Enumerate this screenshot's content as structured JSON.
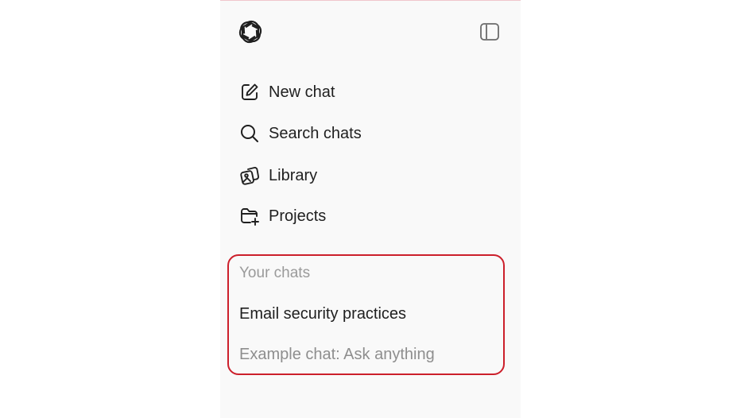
{
  "sidebar": {
    "logo_icon": "openai-logo-icon",
    "toggle_icon": "sidebar-toggle-icon",
    "nav": [
      {
        "label": "New chat",
        "icon": "edit-icon"
      },
      {
        "label": "Search chats",
        "icon": "search-icon"
      },
      {
        "label": "Library",
        "icon": "images-icon"
      },
      {
        "label": "Projects",
        "icon": "folder-plus-icon"
      }
    ],
    "chats": {
      "section_label": "Your chats",
      "items": [
        {
          "label": "Email security practices"
        },
        {
          "label": "Example chat: Ask anything"
        }
      ],
      "highlight_color": "#cc1f2b"
    }
  }
}
